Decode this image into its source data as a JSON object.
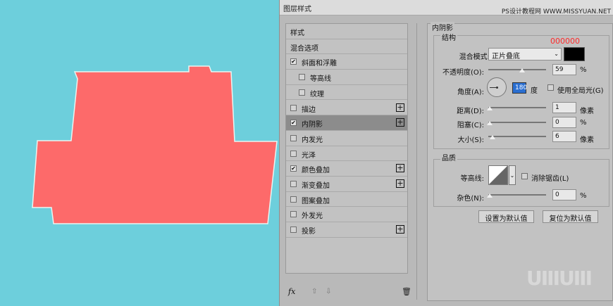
{
  "dialog": {
    "title": "图层样式",
    "site_watermark": "PS设计教程网 WWW.MISSYUAN.NET",
    "brand_watermark": "UIIIUIII"
  },
  "styles": {
    "header": "样式",
    "items": [
      {
        "label": "混合选项",
        "checkbox": false,
        "checked": false,
        "indent": 0,
        "plus": false,
        "selected": false
      },
      {
        "label": "斜面和浮雕",
        "checkbox": true,
        "checked": true,
        "indent": 0,
        "plus": false,
        "selected": false
      },
      {
        "label": "等高线",
        "checkbox": true,
        "checked": false,
        "indent": 1,
        "plus": false,
        "selected": false
      },
      {
        "label": "纹理",
        "checkbox": true,
        "checked": false,
        "indent": 1,
        "plus": false,
        "selected": false
      },
      {
        "label": "描边",
        "checkbox": true,
        "checked": false,
        "indent": 0,
        "plus": true,
        "selected": false
      },
      {
        "label": "内阴影",
        "checkbox": true,
        "checked": true,
        "indent": 0,
        "plus": true,
        "selected": true
      },
      {
        "label": "内发光",
        "checkbox": true,
        "checked": false,
        "indent": 0,
        "plus": false,
        "selected": false
      },
      {
        "label": "光泽",
        "checkbox": true,
        "checked": false,
        "indent": 0,
        "plus": false,
        "selected": false
      },
      {
        "label": "颜色叠加",
        "checkbox": true,
        "checked": true,
        "indent": 0,
        "plus": true,
        "selected": false
      },
      {
        "label": "渐变叠加",
        "checkbox": true,
        "checked": false,
        "indent": 0,
        "plus": true,
        "selected": false
      },
      {
        "label": "图案叠加",
        "checkbox": true,
        "checked": false,
        "indent": 0,
        "plus": false,
        "selected": false
      },
      {
        "label": "外发光",
        "checkbox": true,
        "checked": false,
        "indent": 0,
        "plus": false,
        "selected": false
      },
      {
        "label": "投影",
        "checkbox": true,
        "checked": false,
        "indent": 0,
        "plus": true,
        "selected": false
      }
    ],
    "fx_label": "fx",
    "check_glyph": "✔",
    "plus_glyph": "+"
  },
  "inner_shadow": {
    "section_title": "内阴影",
    "structure_title": "结构",
    "color_annotation": "000000",
    "shadow_color": "#000000",
    "blend_mode_label": "混合模式:",
    "blend_mode_value": "正片叠底",
    "opacity_label": "不透明度(O):",
    "opacity_value": "59",
    "opacity_fraction": 0.59,
    "opacity_unit": "%",
    "angle_label": "角度(A):",
    "angle_value": "180",
    "angle_unit": "度",
    "global_light_label": "使用全局光(G)",
    "distance_label": "距离(D):",
    "distance_value": "1",
    "distance_unit": "像素",
    "choke_label": "阻塞(C):",
    "choke_value": "0",
    "choke_unit": "%",
    "size_label": "大小(S):",
    "size_value": "6",
    "size_unit": "像素",
    "quality_title": "品质",
    "contour_label": "等高线:",
    "anti_alias_label": "消除锯齿(L)",
    "noise_label": "杂色(N):",
    "noise_value": "0",
    "noise_unit": "%",
    "make_default_label": "设置为默认值",
    "reset_default_label": "复位为默认值"
  },
  "colors": {
    "canvas_bg": "#6dcfdc",
    "shape_fill": "#fd6a6a",
    "annotation_red": "#ff2a2a"
  }
}
